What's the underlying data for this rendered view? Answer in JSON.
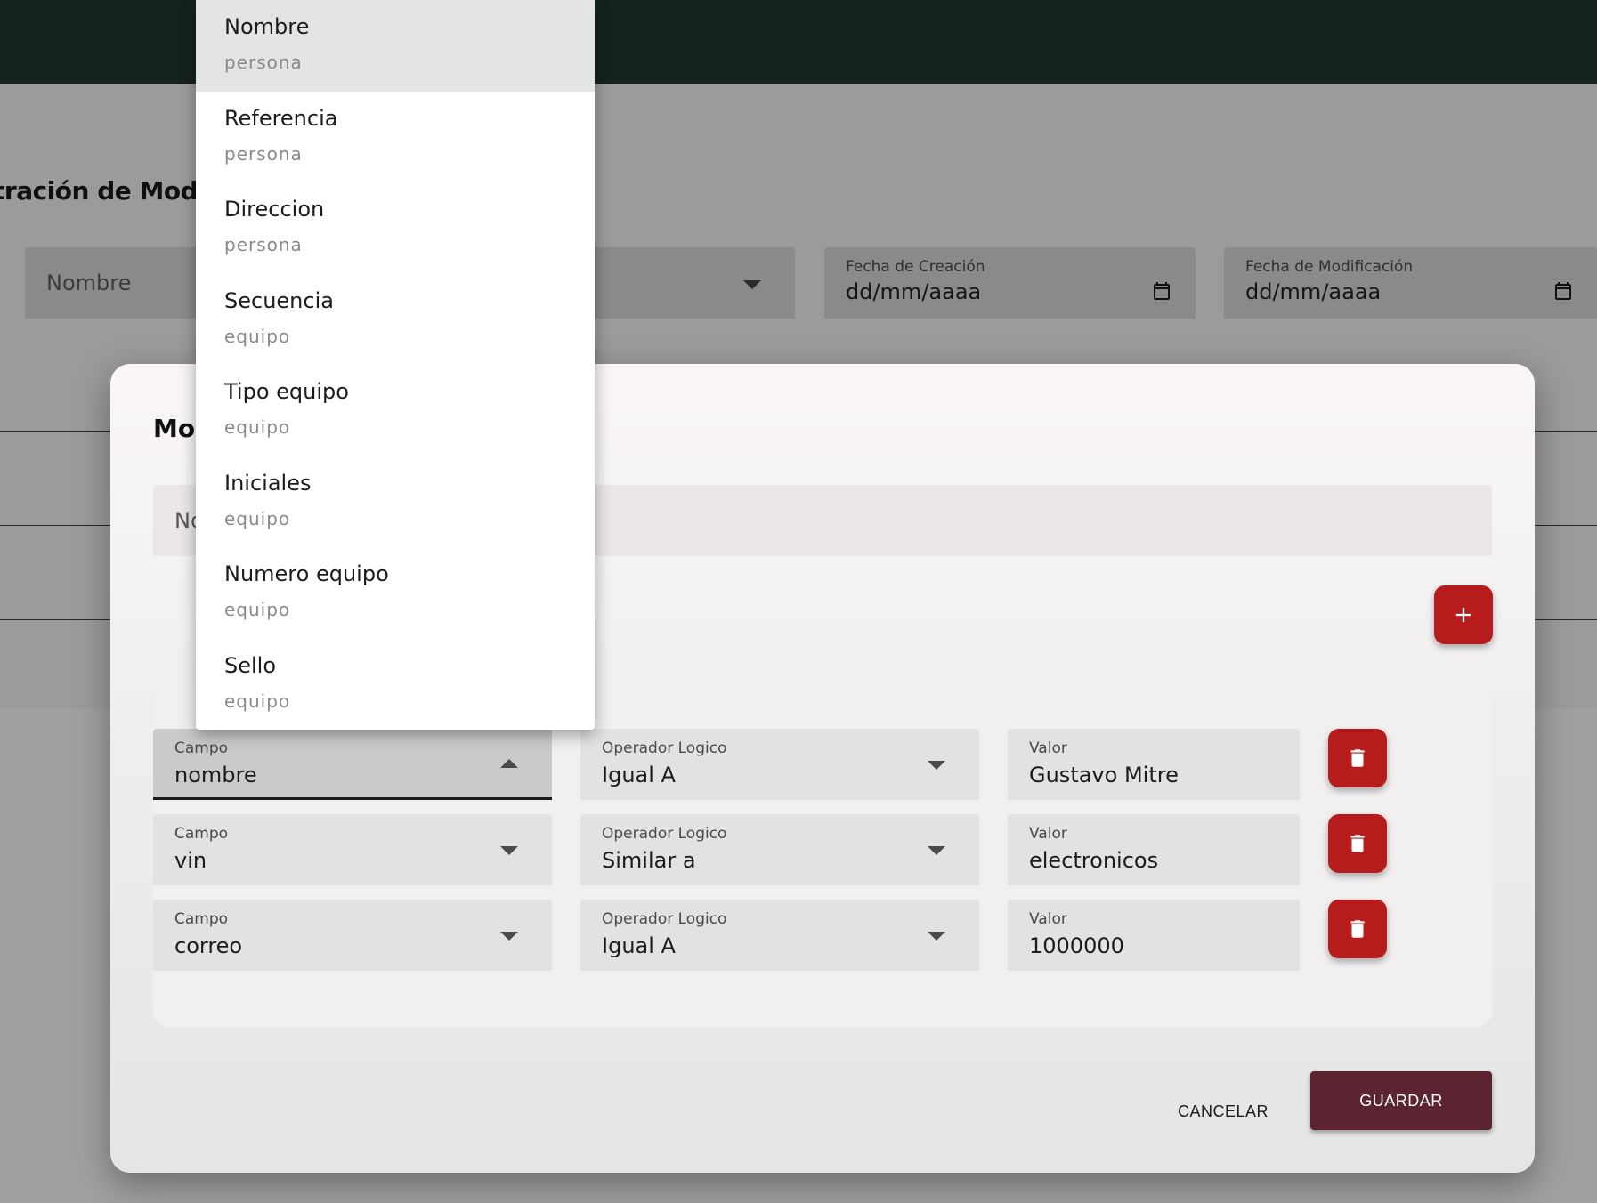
{
  "page": {
    "title": "tración de Modus O",
    "filters": {
      "nombre_placeholder": "Nombre",
      "fecha_creacion": {
        "label": "Fecha de Creación",
        "value": "dd/mm/aaaa"
      },
      "fecha_modificacion": {
        "label": "Fecha de Modificación",
        "value": "dd/mm/aaaa"
      }
    }
  },
  "dialog": {
    "title": "Mod",
    "name_placeholder": "No",
    "add_icon": "plus-icon",
    "rules": [
      {
        "campo_label": "Campo",
        "campo": "nombre",
        "operador_label": "Operador Logico",
        "operador": "Igual A",
        "valor_label": "Valor",
        "valor": "Gustavo Mitre"
      },
      {
        "campo_label": "Campo",
        "campo": "vin",
        "operador_label": "Operador Logico",
        "operador": "Similar a",
        "valor_label": "Valor",
        "valor": "electronicos"
      },
      {
        "campo_label": "Campo",
        "campo": "correo",
        "operador_label": "Operador Logico",
        "operador": "Igual A",
        "valor_label": "Valor",
        "valor": "1000000"
      }
    ],
    "delete_icon": "trash-icon",
    "cancel_label": "CANCELAR",
    "save_label": "GUARDAR"
  },
  "dropdown": {
    "selected_index": 0,
    "options": [
      {
        "label": "Nombre",
        "group": "persona"
      },
      {
        "label": "Referencia",
        "group": "persona"
      },
      {
        "label": "Direccion",
        "group": "persona"
      },
      {
        "label": "Secuencia",
        "group": "equipo"
      },
      {
        "label": "Tipo equipo",
        "group": "equipo"
      },
      {
        "label": "Iniciales",
        "group": "equipo"
      },
      {
        "label": "Numero equipo",
        "group": "equipo"
      },
      {
        "label": "Sello",
        "group": "equipo"
      }
    ]
  },
  "colors": {
    "topbar": "#152220",
    "accent_red": "#b71c1c",
    "save_button": "#5b2430"
  }
}
